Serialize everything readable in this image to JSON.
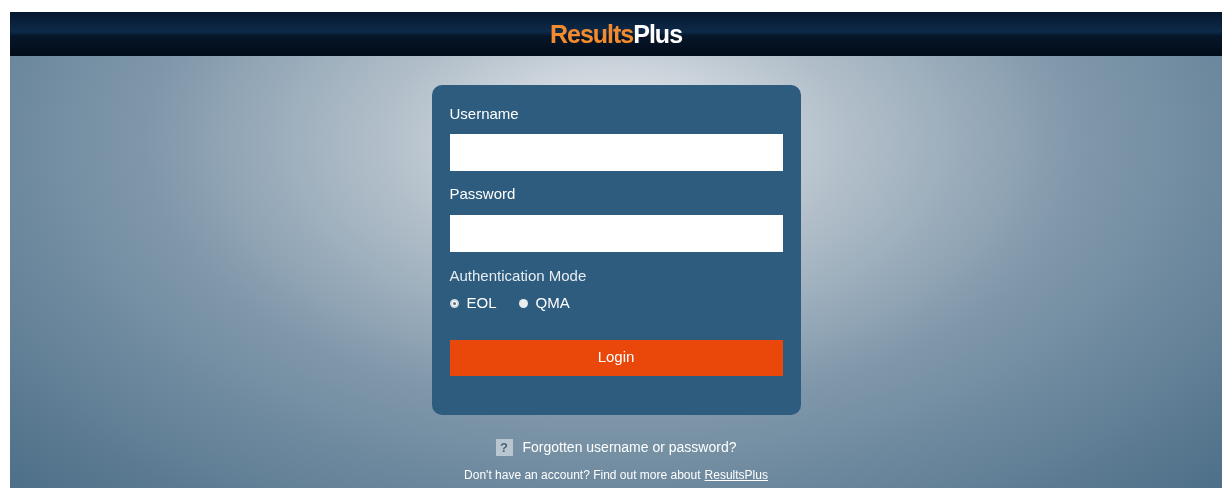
{
  "header": {
    "logo": {
      "primary": "Results",
      "secondary": "Plus"
    }
  },
  "login_form": {
    "username": {
      "label": "Username"
    },
    "password": {
      "label": "Password"
    },
    "auth_mode": {
      "label": "Authentication Mode",
      "options": [
        {
          "label": "EOL",
          "selected": true
        },
        {
          "label": "QMA",
          "selected": false
        }
      ]
    },
    "submit": "Login"
  },
  "help_link": {
    "icon": "?",
    "label": "Forgotten username or password?"
  },
  "account_note": {
    "text": "Don't have an account? Find out more about",
    "link": "ResultsPlus"
  }
}
